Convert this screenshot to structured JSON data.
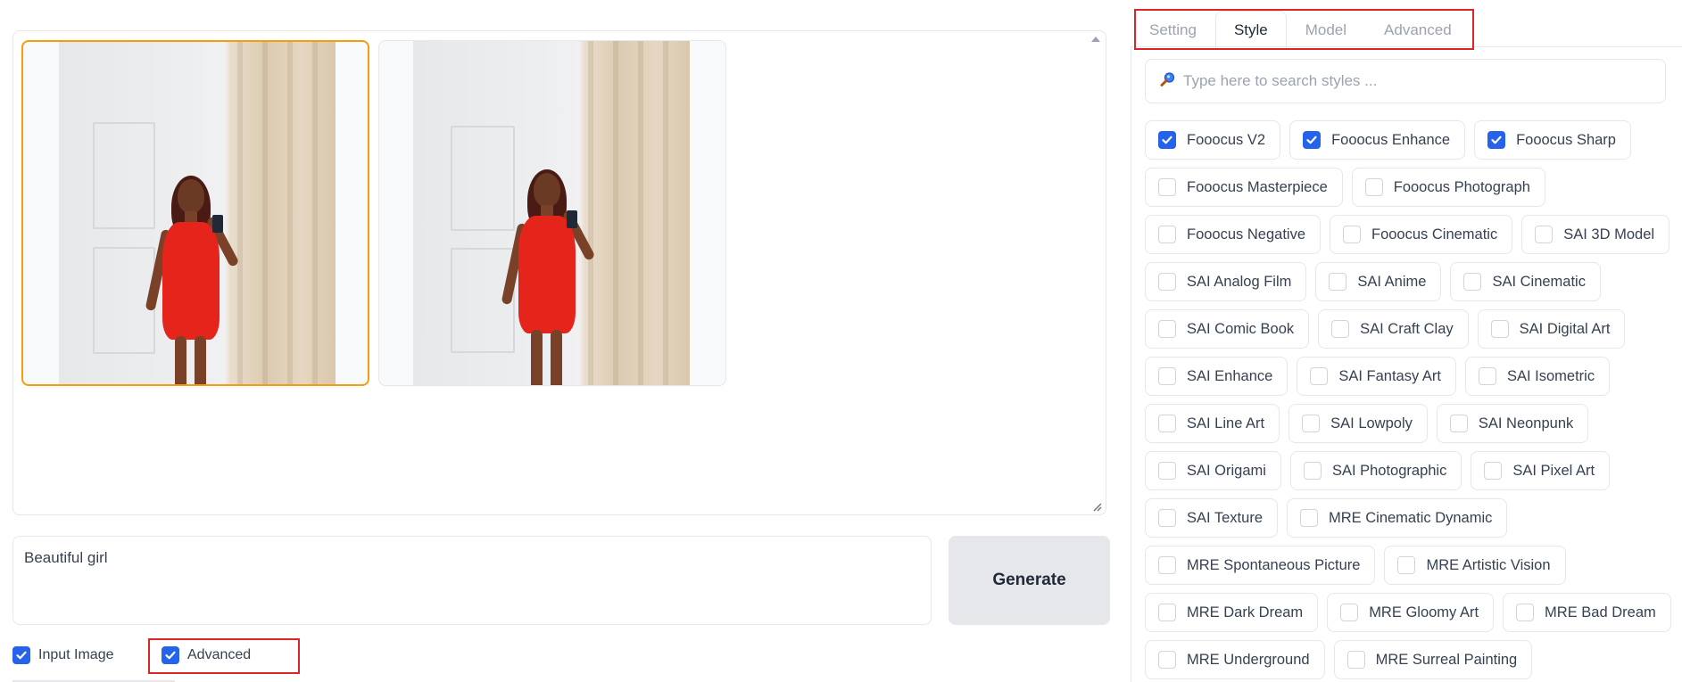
{
  "gallery": {
    "images": [
      {
        "label": "generated-image-1",
        "selected": true
      },
      {
        "label": "generated-image-2",
        "selected": false
      }
    ]
  },
  "prompt": {
    "value": "Beautiful girl"
  },
  "generate": {
    "label": "Generate"
  },
  "options": {
    "input_image": {
      "label": "Input Image",
      "checked": true
    },
    "advanced": {
      "label": "Advanced",
      "checked": true
    }
  },
  "tabs": [
    {
      "label": "Setting",
      "active": false
    },
    {
      "label": "Style",
      "active": true
    },
    {
      "label": "Model",
      "active": false
    },
    {
      "label": "Advanced",
      "active": false
    }
  ],
  "search": {
    "placeholder": "Type here to search styles ...",
    "icon": "magnifier-icon"
  },
  "styles": [
    [
      {
        "label": "Fooocus V2",
        "checked": true
      },
      {
        "label": "Fooocus Enhance",
        "checked": true
      },
      {
        "label": "Fooocus Sharp",
        "checked": true
      }
    ],
    [
      {
        "label": "Fooocus Masterpiece",
        "checked": false
      },
      {
        "label": "Fooocus Photograph",
        "checked": false
      }
    ],
    [
      {
        "label": "Fooocus Negative",
        "checked": false
      },
      {
        "label": "Fooocus Cinematic",
        "checked": false
      },
      {
        "label": "SAI 3D Model",
        "checked": false
      }
    ],
    [
      {
        "label": "SAI Analog Film",
        "checked": false
      },
      {
        "label": "SAI Anime",
        "checked": false
      },
      {
        "label": "SAI Cinematic",
        "checked": false
      }
    ],
    [
      {
        "label": "SAI Comic Book",
        "checked": false
      },
      {
        "label": "SAI Craft Clay",
        "checked": false
      },
      {
        "label": "SAI Digital Art",
        "checked": false
      }
    ],
    [
      {
        "label": "SAI Enhance",
        "checked": false
      },
      {
        "label": "SAI Fantasy Art",
        "checked": false
      },
      {
        "label": "SAI Isometric",
        "checked": false
      }
    ],
    [
      {
        "label": "SAI Line Art",
        "checked": false
      },
      {
        "label": "SAI Lowpoly",
        "checked": false
      },
      {
        "label": "SAI Neonpunk",
        "checked": false
      }
    ],
    [
      {
        "label": "SAI Origami",
        "checked": false
      },
      {
        "label": "SAI Photographic",
        "checked": false
      },
      {
        "label": "SAI Pixel Art",
        "checked": false
      }
    ],
    [
      {
        "label": "SAI Texture",
        "checked": false
      },
      {
        "label": "MRE Cinematic Dynamic",
        "checked": false
      }
    ],
    [
      {
        "label": "MRE Spontaneous Picture",
        "checked": false
      },
      {
        "label": "MRE Artistic Vision",
        "checked": false
      }
    ],
    [
      {
        "label": "MRE Dark Dream",
        "checked": false
      },
      {
        "label": "MRE Gloomy Art",
        "checked": false
      },
      {
        "label": "MRE Bad Dream",
        "checked": false
      }
    ],
    [
      {
        "label": "MRE Underground",
        "checked": false
      },
      {
        "label": "MRE Surreal Painting",
        "checked": false
      }
    ]
  ],
  "colors": {
    "accent": "#2563eb",
    "selected_border": "#f59e0b",
    "highlight_box": "#dc2626"
  }
}
